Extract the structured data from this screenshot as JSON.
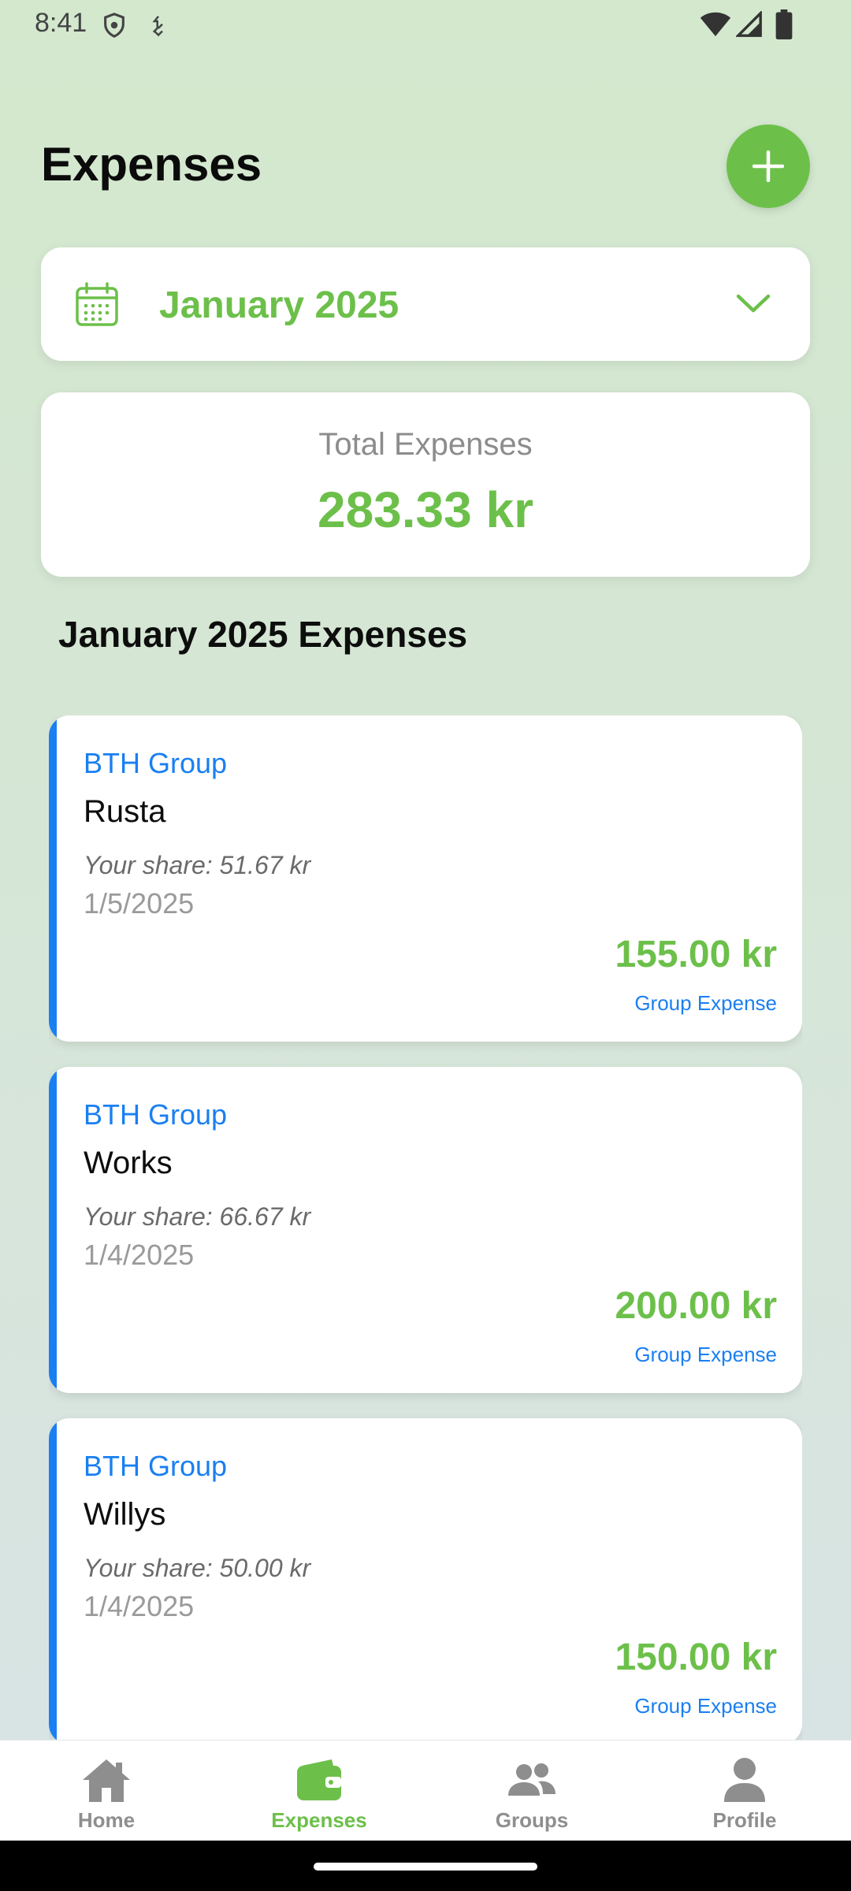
{
  "status_bar": {
    "time": "8:41"
  },
  "header": {
    "title": "Expenses"
  },
  "month_selector": {
    "label": "January 2025"
  },
  "total": {
    "label": "Total Expenses",
    "amount": "283.33 kr"
  },
  "section": {
    "title": "January 2025 Expenses"
  },
  "expenses": [
    {
      "group": "BTH Group",
      "name": "Rusta",
      "share": "Your share: 51.67 kr",
      "date": "1/5/2025",
      "amount": "155.00 kr",
      "type": "Group Expense"
    },
    {
      "group": "BTH Group",
      "name": "Works",
      "share": "Your share: 66.67 kr",
      "date": "1/4/2025",
      "amount": "200.00 kr",
      "type": "Group Expense"
    },
    {
      "group": "BTH Group",
      "name": "Willys",
      "share": "Your share: 50.00 kr",
      "date": "1/4/2025",
      "amount": "150.00 kr",
      "type": "Group Expense"
    }
  ],
  "nav": {
    "items": [
      {
        "label": "Home",
        "icon": "home-icon",
        "active": false
      },
      {
        "label": "Expenses",
        "icon": "wallet-icon",
        "active": true
      },
      {
        "label": "Groups",
        "icon": "groups-icon",
        "active": false
      },
      {
        "label": "Profile",
        "icon": "profile-icon",
        "active": false
      }
    ]
  },
  "colors": {
    "accent_green": "#6cc04a",
    "accent_blue": "#1a7ff2",
    "inactive_gray": "#8e8e8e"
  }
}
